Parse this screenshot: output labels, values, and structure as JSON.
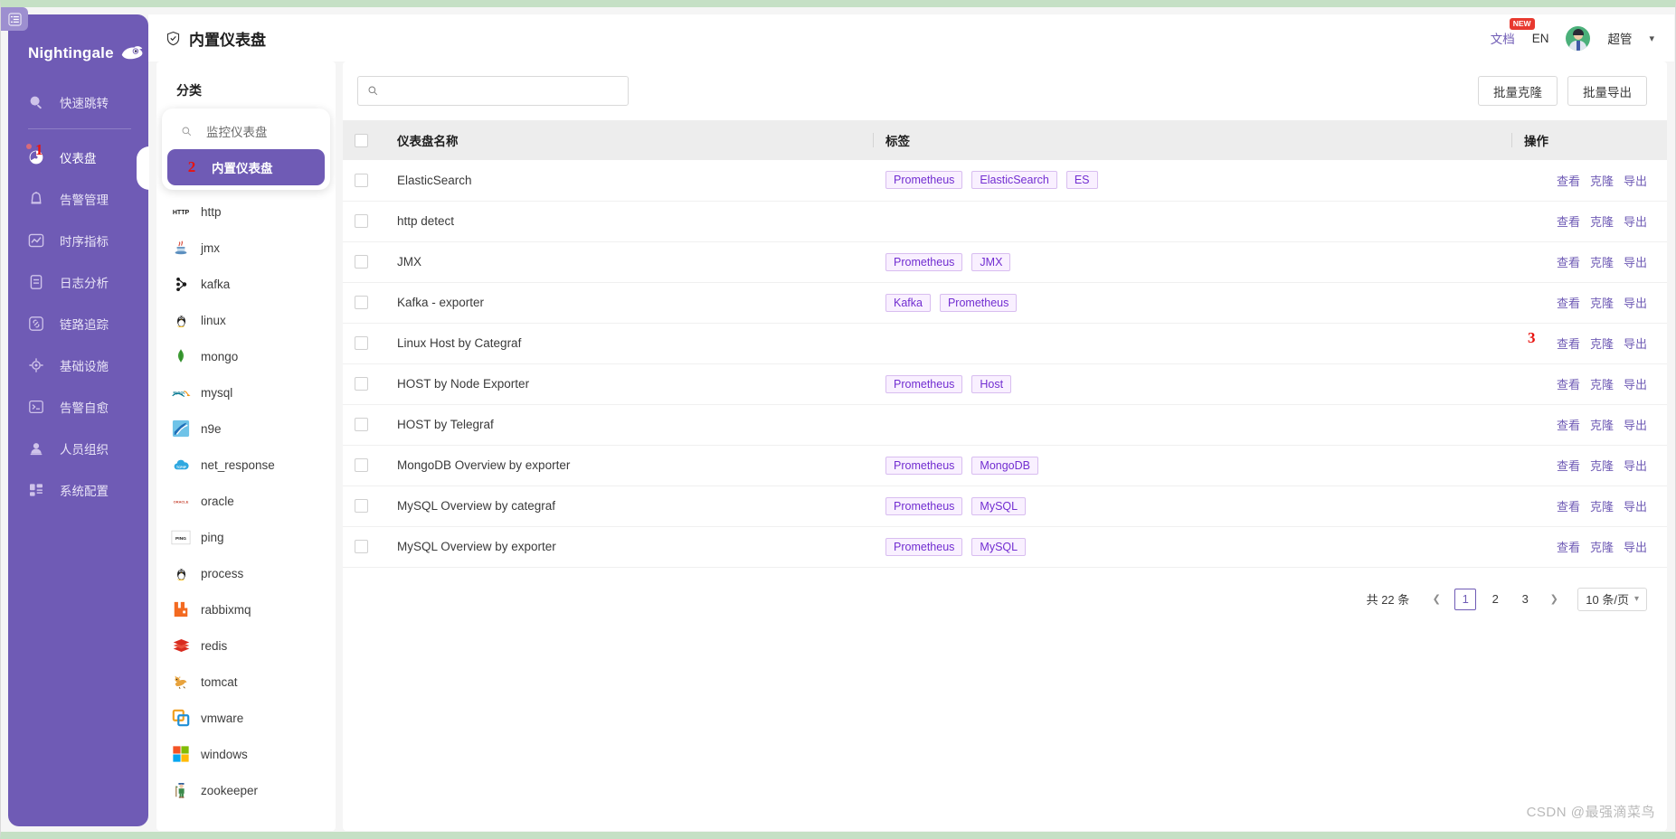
{
  "app": {
    "brand": "Nightingale",
    "brand_logo_icon": "bird-logo-icon",
    "collapse_icon": "menu-collapse-icon"
  },
  "sidebar": {
    "items": [
      {
        "label": "快速跳转",
        "icon": "search-icon",
        "active": false
      },
      {
        "label": "仪表盘",
        "icon": "dashboard-icon",
        "active": true,
        "annotation": "1"
      },
      {
        "label": "告警管理",
        "icon": "bell-icon",
        "active": false
      },
      {
        "label": "时序指标",
        "icon": "chart-line-icon",
        "active": false
      },
      {
        "label": "日志分析",
        "icon": "document-icon",
        "active": false
      },
      {
        "label": "链路追踪",
        "icon": "link-icon",
        "active": false
      },
      {
        "label": "基础设施",
        "icon": "target-icon",
        "active": false
      },
      {
        "label": "告警自愈",
        "icon": "terminal-icon",
        "active": false
      },
      {
        "label": "人员组织",
        "icon": "user-icon",
        "active": false
      },
      {
        "label": "系统配置",
        "icon": "grid-icon",
        "active": false
      }
    ]
  },
  "header": {
    "title": "内置仪表盘",
    "title_icon": "shield-check-icon",
    "doc_label": "文档",
    "doc_badge": "NEW",
    "lang_label": "EN",
    "avatar_icon": "user-avatar",
    "user_name": "超管",
    "caret_icon": "chevron-down-icon"
  },
  "category": {
    "title": "分类",
    "search_placeholder": "监控仪表盘",
    "search_icon": "search-icon",
    "selected_label": "内置仪表盘",
    "selected_annotation": "2",
    "items": [
      {
        "label": "http",
        "icon": "http-icon"
      },
      {
        "label": "jmx",
        "icon": "java-icon"
      },
      {
        "label": "kafka",
        "icon": "kafka-icon"
      },
      {
        "label": "linux",
        "icon": "linux-icon"
      },
      {
        "label": "mongo",
        "icon": "mongodb-icon"
      },
      {
        "label": "mysql",
        "icon": "mysql-icon"
      },
      {
        "label": "n9e",
        "icon": "n9e-icon"
      },
      {
        "label": "net_response",
        "icon": "tcpip-cloud-icon"
      },
      {
        "label": "oracle",
        "icon": "oracle-icon"
      },
      {
        "label": "ping",
        "icon": "ping-icon"
      },
      {
        "label": "process",
        "icon": "linux-icon"
      },
      {
        "label": "rabbixmq",
        "icon": "rabbitmq-icon"
      },
      {
        "label": "redis",
        "icon": "redis-icon"
      },
      {
        "label": "tomcat",
        "icon": "tomcat-icon"
      },
      {
        "label": "vmware",
        "icon": "vmware-icon"
      },
      {
        "label": "windows",
        "icon": "windows-icon"
      },
      {
        "label": "zookeeper",
        "icon": "zookeeper-icon"
      }
    ]
  },
  "toolbar": {
    "search_value": "",
    "search_placeholder": "",
    "search_icon": "search-icon",
    "batch_clone_label": "批量克隆",
    "batch_export_label": "批量导出"
  },
  "table": {
    "columns": {
      "name": "仪表盘名称",
      "tags": "标签",
      "ops": "操作"
    },
    "ops_labels": {
      "view": "查看",
      "clone": "克隆",
      "export": "导出"
    },
    "annotation_row_index": 4,
    "annotation_value": "3",
    "rows": [
      {
        "name": "ElasticSearch",
        "tags": [
          "Prometheus",
          "ElasticSearch",
          "ES"
        ]
      },
      {
        "name": "http detect",
        "tags": []
      },
      {
        "name": "JMX",
        "tags": [
          "Prometheus",
          "JMX"
        ]
      },
      {
        "name": "Kafka - exporter",
        "tags": [
          "Kafka",
          "Prometheus"
        ]
      },
      {
        "name": "Linux Host by Categraf",
        "tags": []
      },
      {
        "name": "HOST by Node Exporter",
        "tags": [
          "Prometheus",
          "Host"
        ]
      },
      {
        "name": "HOST by Telegraf",
        "tags": []
      },
      {
        "name": "MongoDB Overview by exporter",
        "tags": [
          "Prometheus",
          "MongoDB"
        ]
      },
      {
        "name": "MySQL Overview by categraf",
        "tags": [
          "Prometheus",
          "MySQL"
        ]
      },
      {
        "name": "MySQL Overview by exporter",
        "tags": [
          "Prometheus",
          "MySQL"
        ]
      }
    ]
  },
  "pagination": {
    "total_label": "共 22 条",
    "prev_icon": "chevron-left-icon",
    "next_icon": "chevron-right-icon",
    "pages": [
      "1",
      "2",
      "3"
    ],
    "current_page": "1",
    "page_size_label": "10 条/页",
    "page_size_caret": "chevron-down-icon"
  },
  "watermark": "CSDN @最强滴菜鸟",
  "colors": {
    "sidebar": "#6f5bb5",
    "accent": "#6f5bb5",
    "tag_text": "#722ed1",
    "tag_bg": "#f9f0ff",
    "annotation_red": "#e8130f"
  }
}
